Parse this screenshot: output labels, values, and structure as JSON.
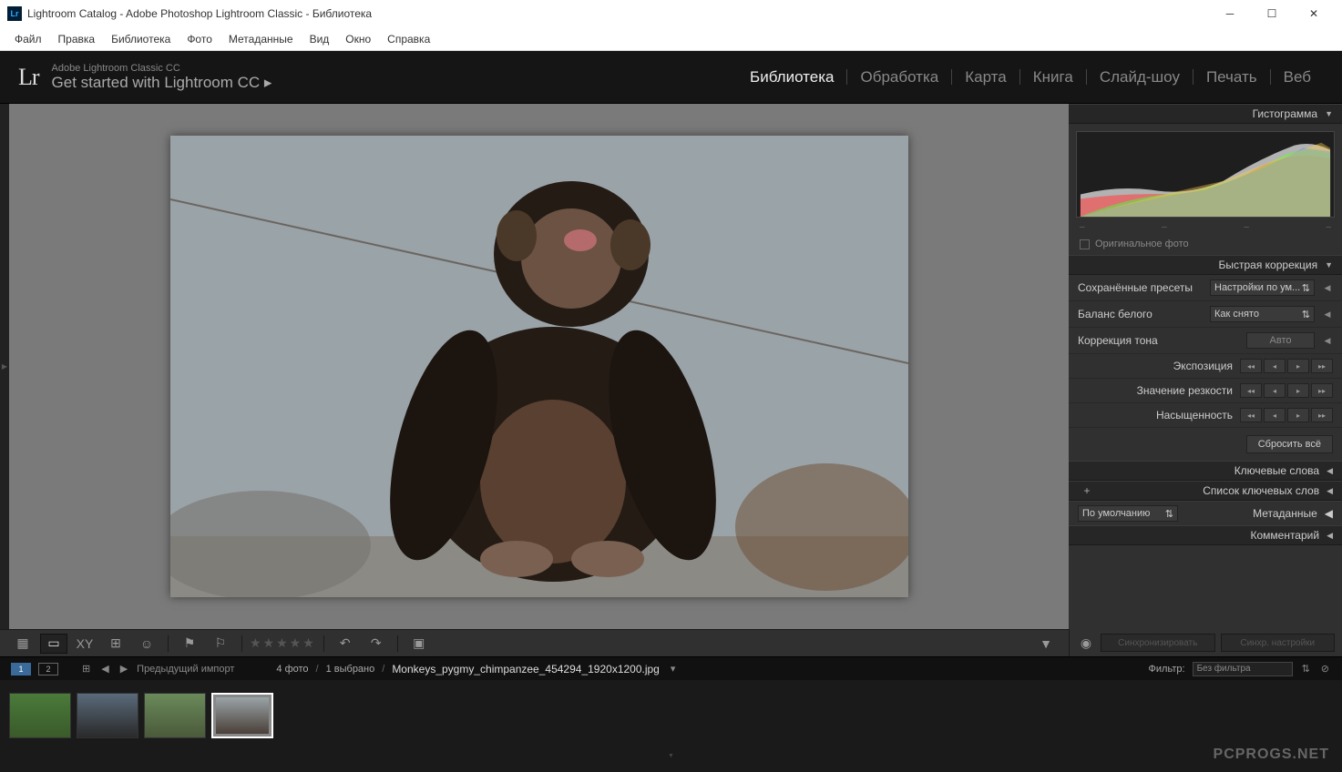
{
  "window": {
    "title": "Lightroom Catalog - Adobe Photoshop Lightroom Classic - Библиотека"
  },
  "menubar": [
    "Файл",
    "Правка",
    "Библиотека",
    "Фото",
    "Метаданные",
    "Вид",
    "Окно",
    "Справка"
  ],
  "branding": {
    "small": "Adobe Lightroom Classic CC",
    "large": "Get started with Lightroom CC  ▸"
  },
  "modules": [
    "Библиотека",
    "Обработка",
    "Карта",
    "Книга",
    "Слайд-шоу",
    "Печать",
    "Веб"
  ],
  "module_active": 0,
  "right": {
    "histogram": "Гистограмма",
    "original_photo": "Оригинальное фото",
    "quick": {
      "header": "Быстрая коррекция",
      "presets_label": "Сохранённые пресеты",
      "presets_value": "Настройки по ум...",
      "wb_label": "Баланс белого",
      "wb_value": "Как снято",
      "tone_label": "Коррекция тона",
      "tone_btn": "Авто",
      "exposure": "Экспозиция",
      "clarity": "Значение резкости",
      "saturation": "Насыщенность",
      "reset": "Сбросить всё"
    },
    "keywords": "Ключевые слова",
    "keyword_list": "Список ключевых слов",
    "metadata_label": "Метаданные",
    "metadata_sel": "По умолчанию",
    "comments": "Комментарий"
  },
  "sync": {
    "sync": "Синхронизировать",
    "settings": "Синхр. настройки"
  },
  "filter": {
    "prev_import": "Предыдущий импорт",
    "count": "4 фото",
    "selected": "1 выбрано",
    "filename": "Monkeys_pygmy_chimpanzee_454294_1920x1200.jpg",
    "filter_label": "Фильтр:",
    "filter_value": "Без фильтра"
  },
  "watermark": "PCPROGS.NET"
}
